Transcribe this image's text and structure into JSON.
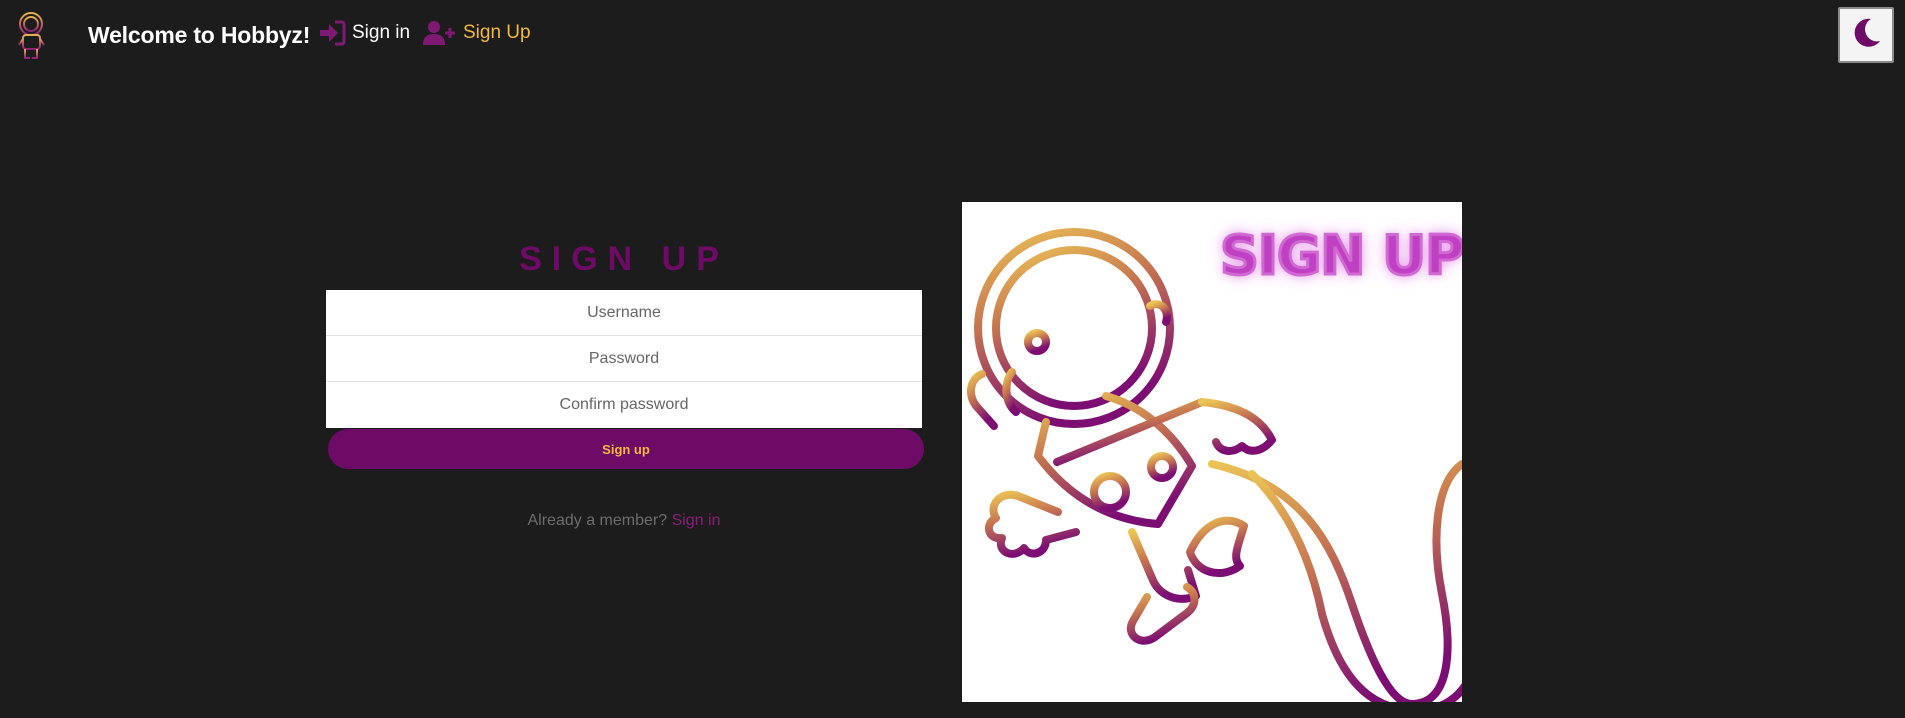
{
  "navbar": {
    "brand": "Welcome to Hobbyz!",
    "links": [
      {
        "label": "Sign in",
        "icon": "sign-in-icon"
      },
      {
        "label": "Sign Up",
        "icon": "user-plus-icon"
      }
    ],
    "theme_toggle_icon": "moon-icon"
  },
  "form": {
    "title": "SIGN UP",
    "fields": [
      {
        "placeholder": "Username"
      },
      {
        "placeholder": "Password"
      },
      {
        "placeholder": "Confirm password"
      }
    ],
    "submit_label": "Sign up",
    "member_prompt": "Already a member?",
    "member_link": "Sign in"
  },
  "art": {
    "headline": "SIGN UP",
    "icon": "astronaut-icon"
  },
  "colors": {
    "background": "#1c1c1c",
    "primary_purple": "#6e0b66",
    "accent_gold": "#f3b940",
    "neon_pink": "#c040c4"
  }
}
